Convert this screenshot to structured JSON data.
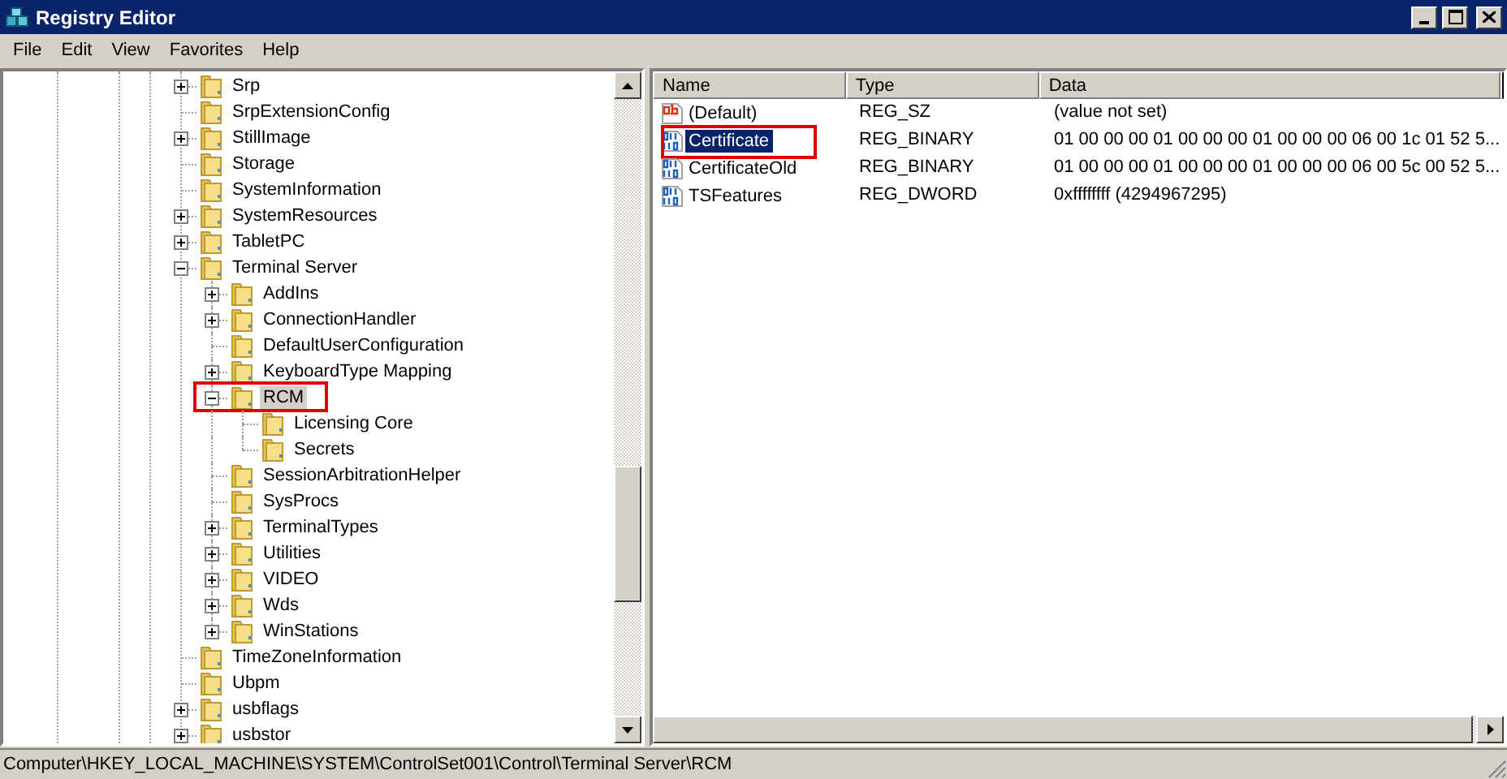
{
  "window": {
    "title": "Registry Editor"
  },
  "menu": [
    "File",
    "Edit",
    "View",
    "Favorites",
    "Help"
  ],
  "tree": [
    {
      "label": "Srp",
      "expandable": true,
      "expanded": false,
      "selected": false,
      "boxed": false
    },
    {
      "label": "SrpExtensionConfig",
      "expandable": false,
      "selected": false,
      "boxed": false
    },
    {
      "label": "StillImage",
      "expandable": true,
      "expanded": false,
      "selected": false,
      "boxed": false
    },
    {
      "label": "Storage",
      "expandable": false,
      "selected": false,
      "boxed": false
    },
    {
      "label": "SystemInformation",
      "expandable": false,
      "selected": false,
      "boxed": false
    },
    {
      "label": "SystemResources",
      "expandable": true,
      "expanded": false,
      "selected": false,
      "boxed": false
    },
    {
      "label": "TabletPC",
      "expandable": true,
      "expanded": false,
      "selected": false,
      "boxed": false
    },
    {
      "label": "Terminal Server",
      "expandable": true,
      "expanded": true,
      "selected": false,
      "boxed": false,
      "children": [
        {
          "label": "AddIns",
          "expandable": true,
          "expanded": false,
          "selected": false,
          "boxed": false
        },
        {
          "label": "ConnectionHandler",
          "expandable": true,
          "expanded": false,
          "selected": false,
          "boxed": false
        },
        {
          "label": "DefaultUserConfiguration",
          "expandable": false,
          "selected": false,
          "boxed": false
        },
        {
          "label": "KeyboardType Mapping",
          "expandable": true,
          "expanded": false,
          "selected": false,
          "boxed": false
        },
        {
          "label": "RCM",
          "expandable": true,
          "expanded": true,
          "selected": true,
          "boxed": true,
          "children": [
            {
              "label": "Licensing Core",
              "expandable": false,
              "selected": false,
              "boxed": false
            },
            {
              "label": "Secrets",
              "expandable": false,
              "selected": false,
              "boxed": false
            }
          ]
        },
        {
          "label": "SessionArbitrationHelper",
          "expandable": false,
          "selected": false,
          "boxed": false
        },
        {
          "label": "SysProcs",
          "expandable": false,
          "selected": false,
          "boxed": false
        },
        {
          "label": "TerminalTypes",
          "expandable": true,
          "expanded": false,
          "selected": false,
          "boxed": false
        },
        {
          "label": "Utilities",
          "expandable": true,
          "expanded": false,
          "selected": false,
          "boxed": false
        },
        {
          "label": "VIDEO",
          "expandable": true,
          "expanded": false,
          "selected": false,
          "boxed": false
        },
        {
          "label": "Wds",
          "expandable": true,
          "expanded": false,
          "selected": false,
          "boxed": false
        },
        {
          "label": "WinStations",
          "expandable": true,
          "expanded": false,
          "selected": false,
          "boxed": false
        }
      ]
    },
    {
      "label": "TimeZoneInformation",
      "expandable": false,
      "selected": false,
      "boxed": false
    },
    {
      "label": "Ubpm",
      "expandable": false,
      "selected": false,
      "boxed": false
    },
    {
      "label": "usbflags",
      "expandable": true,
      "expanded": false,
      "selected": false,
      "boxed": false
    },
    {
      "label": "usbstor",
      "expandable": true,
      "expanded": false,
      "selected": false,
      "boxed": false
    }
  ],
  "values": {
    "columns": [
      "Name",
      "Type",
      "Data"
    ],
    "rows": [
      {
        "kind": "string",
        "name": "(Default)",
        "type": "REG_SZ",
        "data": "(value not set)",
        "selected": false,
        "boxed": false
      },
      {
        "kind": "binary",
        "name": "Certificate",
        "type": "REG_BINARY",
        "data": "01 00 00 00 01 00 00 00 01 00 00 00 06 00 1c 01 52 5...",
        "selected": true,
        "boxed": true
      },
      {
        "kind": "binary",
        "name": "CertificateOld",
        "type": "REG_BINARY",
        "data": "01 00 00 00 01 00 00 00 01 00 00 00 06 00 5c 00 52 5...",
        "selected": false,
        "boxed": false
      },
      {
        "kind": "binary",
        "name": "TSFeatures",
        "type": "REG_DWORD",
        "data": "0xffffffff (4294967295)",
        "selected": false,
        "boxed": false
      }
    ]
  },
  "status_bar": "Computer\\HKEY_LOCAL_MACHINE\\SYSTEM\\ControlSet001\\Control\\Terminal Server\\RCM"
}
